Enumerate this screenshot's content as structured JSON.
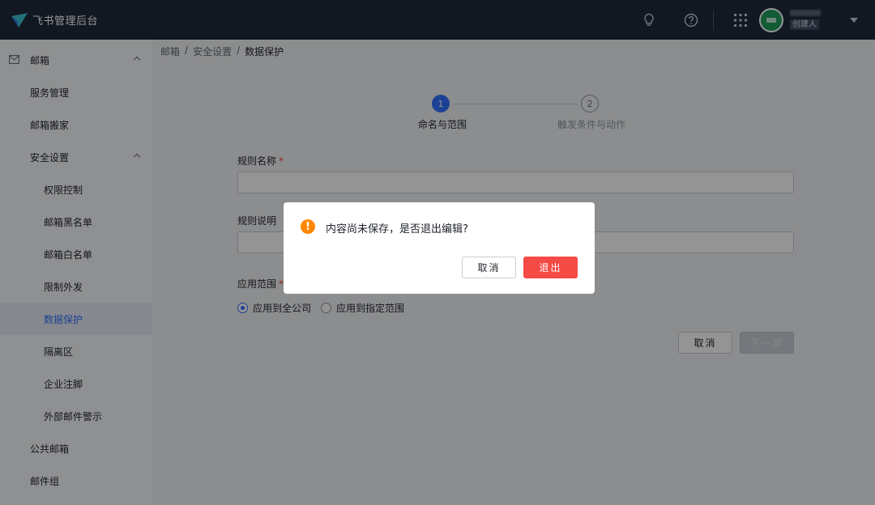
{
  "app": {
    "title": "飞书管理后台"
  },
  "header": {
    "role_badge": "创建人"
  },
  "sidebar": {
    "items": [
      {
        "label": "邮箱",
        "level": 0,
        "expandable": true
      },
      {
        "label": "服务管理",
        "level": 1
      },
      {
        "label": "邮箱搬家",
        "level": 1
      },
      {
        "label": "安全设置",
        "level": 1,
        "expandable": true
      },
      {
        "label": "权限控制",
        "level": 2
      },
      {
        "label": "邮箱黑名单",
        "level": 2
      },
      {
        "label": "邮箱白名单",
        "level": 2
      },
      {
        "label": "限制外发",
        "level": 2
      },
      {
        "label": "数据保护",
        "level": 2,
        "active": true
      },
      {
        "label": "隔离区",
        "level": 2
      },
      {
        "label": "企业注脚",
        "level": 2
      },
      {
        "label": "外部邮件警示",
        "level": 2
      },
      {
        "label": "公共邮箱",
        "level": 1
      },
      {
        "label": "邮件组",
        "level": 1
      }
    ]
  },
  "breadcrumb": [
    "邮箱",
    "安全设置",
    "数据保护"
  ],
  "breadcrumb_separator": "/",
  "steps": [
    {
      "number": "1",
      "label": "命名与范围",
      "active": true
    },
    {
      "number": "2",
      "label": "触发条件与动作",
      "active": false
    }
  ],
  "form": {
    "rule_name_label": "规则名称",
    "rule_desc_label": "规则说明",
    "scope_label": "应用范围",
    "required_mark": "*",
    "scope_options": [
      {
        "label": "应用到全公司",
        "checked": true
      },
      {
        "label": "应用到指定范围",
        "checked": false
      }
    ],
    "cancel_label": "取消",
    "next_label": "下一步"
  },
  "dialog": {
    "icon": "warning-icon",
    "title": "内容尚未保存，是否退出编辑?",
    "cancel_label": "取消",
    "confirm_label": "退出"
  },
  "colors": {
    "topbar": "#1f2a3c",
    "accent": "#3370ff",
    "danger": "#f54a45",
    "warning": "#ff8800"
  }
}
